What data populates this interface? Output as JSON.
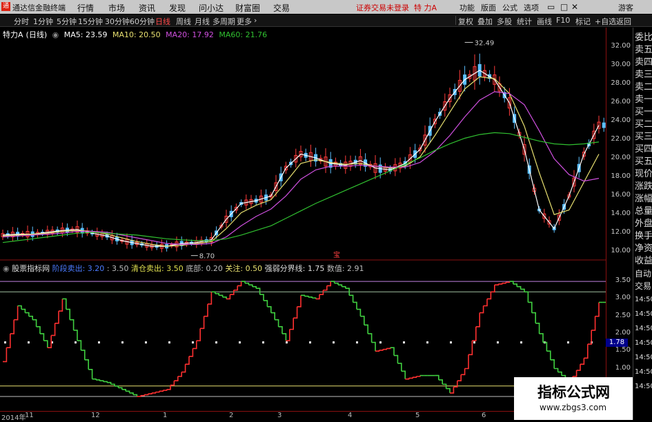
{
  "app": {
    "name": "通达信金融终端",
    "menus": [
      "行情",
      "市场",
      "资讯",
      "发现",
      "问小达",
      "财富圈",
      "交易"
    ],
    "status_msg": "证券交易未登录",
    "stock_title": "特 力A",
    "right_menus": [
      "功能",
      "版面",
      "公式",
      "选项"
    ],
    "user": "游客"
  },
  "periods": [
    "分时",
    "1分钟",
    "5分钟",
    "15分钟",
    "30分钟",
    "60分钟",
    "日线",
    "周线",
    "月线",
    "多周期",
    "更多"
  ],
  "active_period": "日线",
  "toolbar_right": [
    "复权",
    "叠加",
    "多股",
    "统计",
    "画线",
    "F10",
    "标记",
    "+自选",
    "返回"
  ],
  "main_legend": {
    "stock": "特力A",
    "period": "(日线)",
    "ma5": "MA5: 23.59",
    "ma10": "MA10: 20.50",
    "ma20": "MA20: 17.92",
    "ma60": "MA60: 21.76"
  },
  "price_axis": [
    "32.00",
    "30.00",
    "28.00",
    "26.00",
    "24.00",
    "22.00",
    "20.00",
    "18.00",
    "16.00",
    "14.00",
    "12.00",
    "10.00"
  ],
  "annotations": {
    "high": "32.49",
    "low": "8.70",
    "marker": "宝"
  },
  "indicator_legend": {
    "name": "股票指标网",
    "stage_sell": "阶段卖出: 3.20",
    "v350": ": 3.50",
    "clear_sell": "清仓卖出: 3.50",
    "bottom": "底部: 0.20",
    "attention": "关注: 0.50",
    "line": "强弱分界线: 1.75",
    "value": "数值: 2.91"
  },
  "ind_axis": [
    "3.50",
    "3.00",
    "2.50",
    "2.00",
    "1.50",
    "1.00",
    "0.50"
  ],
  "ind_value_box": "1.78",
  "sidebar": [
    "委比",
    "卖五",
    "卖四",
    "卖三",
    "卖二",
    "卖一",
    "买一",
    "买二",
    "买三",
    "买四",
    "买五",
    "现价",
    "涨跌",
    "涨幅",
    "总量",
    "外盘",
    "换手",
    "净资",
    "收益"
  ],
  "sidebar_bottom": [
    "自动",
    "交易"
  ],
  "side_times": [
    "14:50",
    "14:50",
    "14:50",
    "14:50",
    "14:50",
    "14:50",
    "14:50"
  ],
  "dates": [
    "2014年",
    "11",
    "12",
    "1",
    "2",
    "3",
    "4",
    "5",
    "6"
  ],
  "watermark": {
    "title": "指标公式网",
    "url": "www.zbgs3.com"
  },
  "colors": {
    "up": "#ff3b3b",
    "down": "#5cc0ff",
    "ma5": "#ffffff",
    "ma10": "#e8e070",
    "ma20": "#d050e0",
    "ma60": "#30c030"
  },
  "chart_data": {
    "type": "line",
    "series": [
      {
        "name": "MA5",
        "values": [
          11.8,
          11.9,
          11.9,
          12.1,
          12.3,
          12.4,
          12.0,
          11.7,
          11.2,
          10.9,
          10.6,
          10.6,
          10.9,
          11.0,
          11.3,
          13.5,
          15.2,
          15.5,
          16.0,
          19.0,
          20.5,
          20.1,
          19.5,
          19.3,
          19.8,
          19.0,
          18.8,
          19.5,
          21.0,
          24.0,
          26.5,
          28.5,
          29.5,
          28.5,
          26.0,
          21.0,
          14.5,
          12.5,
          16.0,
          20.5,
          23.6
        ]
      },
      {
        "name": "MA10",
        "values": [
          11.7,
          11.8,
          11.9,
          12.0,
          12.2,
          12.3,
          12.2,
          11.9,
          11.5,
          11.1,
          10.8,
          10.6,
          10.7,
          10.9,
          11.1,
          12.5,
          14.2,
          15.0,
          15.6,
          17.5,
          19.5,
          19.9,
          19.6,
          19.4,
          19.5,
          19.2,
          19.0,
          19.2,
          20.2,
          22.5,
          25.0,
          27.5,
          28.8,
          28.6,
          27.0,
          23.5,
          18.5,
          14.0,
          14.5,
          17.5,
          20.5
        ]
      },
      {
        "name": "MA20",
        "values": [
          11.6,
          11.7,
          11.8,
          11.9,
          12.0,
          12.2,
          12.2,
          12.1,
          11.8,
          11.5,
          11.2,
          10.9,
          10.8,
          10.8,
          10.9,
          11.6,
          12.8,
          13.8,
          14.6,
          16.0,
          17.8,
          18.8,
          19.2,
          19.2,
          19.3,
          19.2,
          19.1,
          19.1,
          19.6,
          20.8,
          22.5,
          24.5,
          26.3,
          27.2,
          27.0,
          25.8,
          23.0,
          20.0,
          18.3,
          17.6,
          17.9
        ]
      },
      {
        "name": "MA60",
        "values": [
          11.0,
          11.2,
          11.4,
          11.6,
          11.8,
          12.0,
          12.1,
          12.0,
          11.9,
          11.8,
          11.6,
          11.4,
          11.3,
          11.2,
          11.2,
          11.4,
          11.8,
          12.3,
          12.8,
          13.6,
          14.4,
          15.2,
          15.9,
          16.6,
          17.3,
          18.0,
          18.7,
          19.4,
          20.1,
          20.9,
          21.6,
          22.2,
          22.6,
          22.8,
          22.7,
          22.3,
          21.9,
          21.6,
          21.5,
          21.6,
          21.8
        ]
      }
    ],
    "ylim": [
      9.5,
      33.2
    ],
    "indicator": {
      "values": [
        1.2,
        2.8,
        2.4,
        1.6,
        3.0,
        1.8,
        0.7,
        0.6,
        0.4,
        0.2,
        0.3,
        0.4,
        0.9,
        1.8,
        3.2,
        3.0,
        3.5,
        3.3,
        2.6,
        1.8,
        3.1,
        3.0,
        3.5,
        3.3,
        2.5,
        1.5,
        1.6,
        0.7,
        0.8,
        0.8,
        0.3,
        1.0,
        2.6,
        3.4,
        3.5,
        3.2,
        2.0,
        1.0,
        0.6,
        1.3,
        2.9
      ],
      "levels": [
        3.5,
        3.2,
        1.75,
        0.5,
        0.2
      ],
      "ylim": [
        0.1,
        3.7
      ]
    }
  }
}
